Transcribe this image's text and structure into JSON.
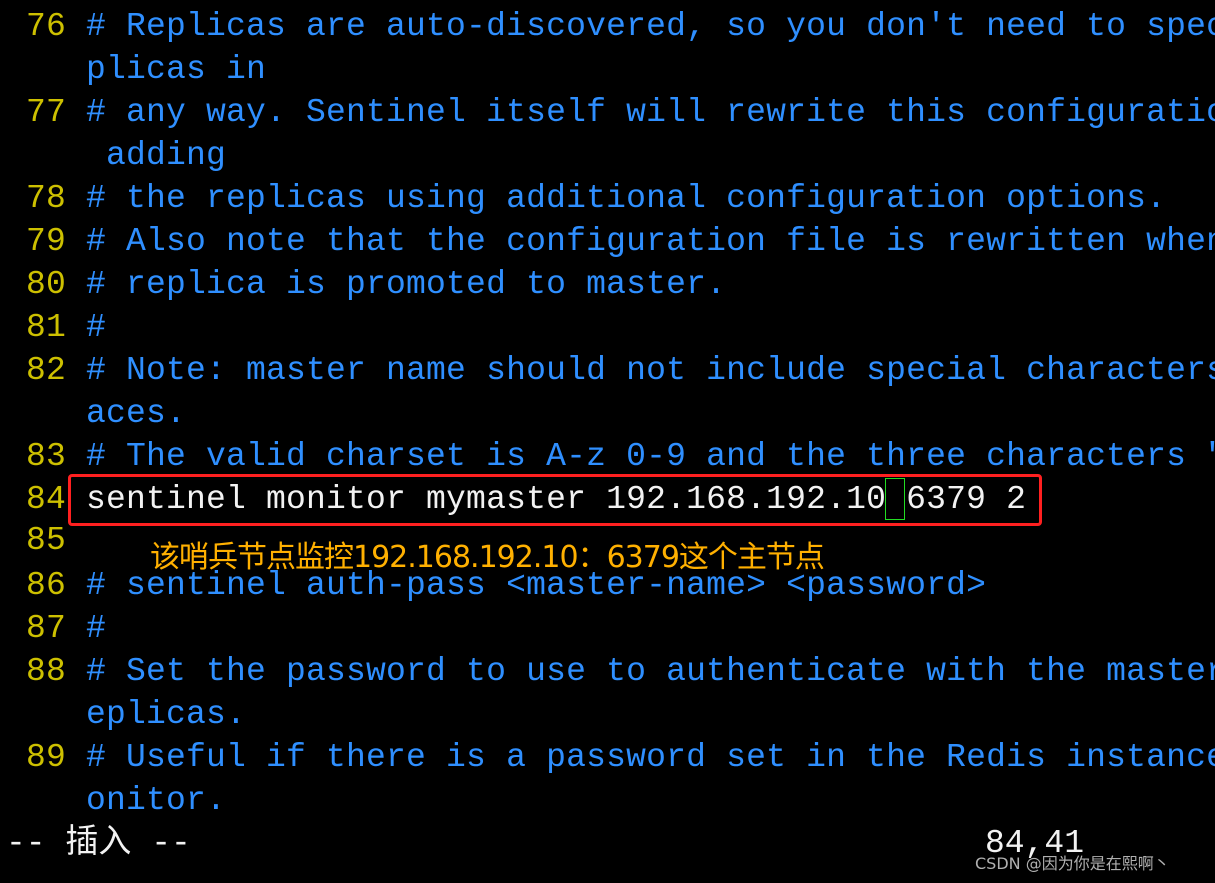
{
  "editor": {
    "lines": [
      {
        "num": "76",
        "text": "# Replicas are auto-discovered, so you don't need to spec",
        "kind": "comment"
      },
      {
        "num": "",
        "text": "plicas in",
        "kind": "comment"
      },
      {
        "num": "77",
        "text": "# any way. Sentinel itself will rewrite this configuratio",
        "kind": "comment"
      },
      {
        "num": "",
        "text": " adding",
        "kind": "comment"
      },
      {
        "num": "78",
        "text": "# the replicas using additional configuration options.",
        "kind": "comment"
      },
      {
        "num": "79",
        "text": "# Also note that the configuration file is rewritten when",
        "kind": "comment"
      },
      {
        "num": "80",
        "text": "# replica is promoted to master.",
        "kind": "comment"
      },
      {
        "num": "81",
        "text": "#",
        "kind": "comment"
      },
      {
        "num": "82",
        "text": "# Note: master name should not include special characters",
        "kind": "comment"
      },
      {
        "num": "",
        "text": "aces.",
        "kind": "comment"
      },
      {
        "num": "83",
        "text": "# The valid charset is A-z 0-9 and the three characters \"",
        "kind": "comment"
      },
      {
        "num": "84",
        "text": "sentinel monitor mymaster 192.168.192.10 6379 2",
        "kind": "code"
      },
      {
        "num": "85",
        "text": "",
        "kind": "code"
      },
      {
        "num": "86",
        "text": "# sentinel auth-pass <master-name> <password>",
        "kind": "comment"
      },
      {
        "num": "87",
        "text": "#",
        "kind": "comment"
      },
      {
        "num": "88",
        "text": "# Set the password to use to authenticate with the master",
        "kind": "comment"
      },
      {
        "num": "",
        "text": "eplicas.",
        "kind": "comment"
      },
      {
        "num": "89",
        "text": "# Useful if there is a password set in the Redis instance",
        "kind": "comment"
      },
      {
        "num": "",
        "text": "onitor.",
        "kind": "comment"
      }
    ],
    "annotation": "该哨兵节点监控192.168.192.10：6379这个主节点",
    "status_mode": "-- 插入 --",
    "cursor_position": "84,41",
    "watermark": "CSDN @因为你是在熙啊丶"
  },
  "colors": {
    "background": "#000000",
    "comment": "#2f8fff",
    "line_number": "#cdc000",
    "highlight_box": "#ff2020",
    "annotation": "#ffb000",
    "cursor": "#22dd22"
  }
}
